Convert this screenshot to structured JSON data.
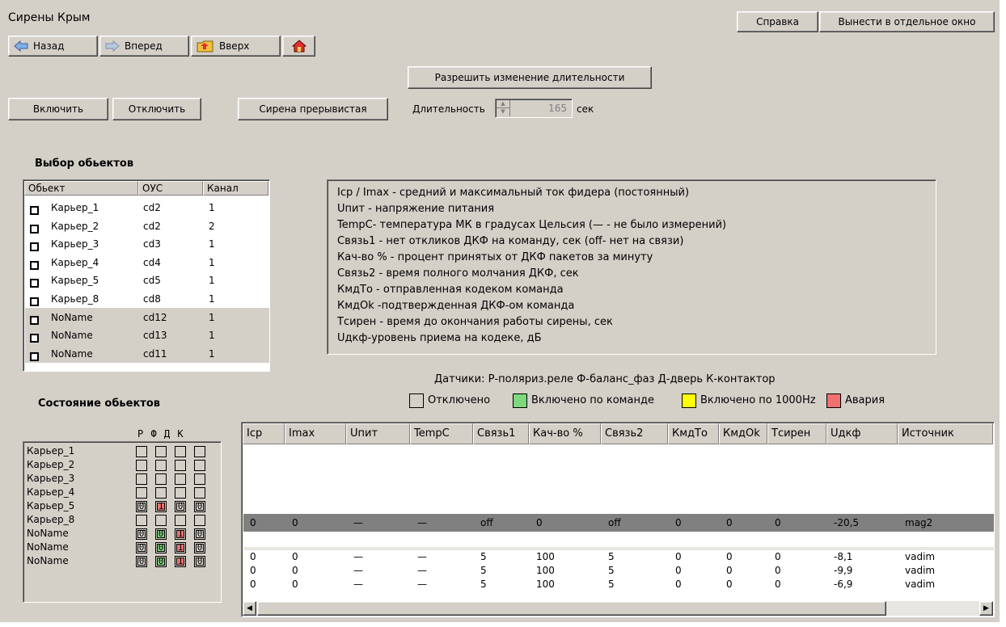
{
  "window": {
    "title": "Сирены Крым"
  },
  "top_buttons": {
    "help": "Справка",
    "detach": "Вынести в отдельное окно"
  },
  "nav": {
    "back": "Назад",
    "forward": "Вперед",
    "up": "Вверх"
  },
  "controls": {
    "allow_duration": "Разрешить изменение длительности",
    "on": "Включить",
    "off": "Отключить",
    "siren_mode": "Сирена прерывистая",
    "duration_label": "Длительность",
    "duration_value": "165",
    "duration_unit": "сек"
  },
  "objects": {
    "title": "Выбор обьектов",
    "headers": [
      "Обьект",
      "ОУС",
      "Канал"
    ],
    "rows": [
      {
        "name": "Карьер_1",
        "ous": "cd2",
        "channel": "1"
      },
      {
        "name": "Карьер_2",
        "ous": "cd2",
        "channel": "2"
      },
      {
        "name": "Карьер_3",
        "ous": "cd3",
        "channel": "1"
      },
      {
        "name": "Карьер_4",
        "ous": "cd4",
        "channel": "1"
      },
      {
        "name": "Карьер_5",
        "ous": "cd5",
        "channel": "1"
      },
      {
        "name": "Карьер_8",
        "ous": "cd8",
        "channel": "1"
      },
      {
        "name": "NoName",
        "ous": "cd12",
        "channel": "1"
      },
      {
        "name": "NoName",
        "ous": "cd13",
        "channel": "1"
      },
      {
        "name": "NoName",
        "ous": "cd11",
        "channel": "1"
      }
    ]
  },
  "legend": {
    "lines": [
      "Icp / Imax - средний и максимальный ток фидера (постоянный)",
      "Uпит - напряжение питания",
      "TempC- температура МК в градусах Цельсия (— - не было измерений)",
      "Связь1 - нет откликов ДКФ на команду, сек (off- нет на связи)",
      "Кач-во % - процент принятых от ДКФ пакетов за минуту",
      "Связь2 - время полного молчания ДКФ, сек",
      "КмдТо - отправленная кодеком команда",
      "КмдOk -подтвержденная  ДКФ-ом команда",
      "Тсирен - время до окончания работы сирены, сек",
      "Uдкф-уровень приема на кодеке, дБ"
    ],
    "sensors": "Датчики: Р-поляриз.реле  Ф-баланс_фаз  Д-дверь  К-контактор",
    "status": [
      {
        "label": "Отключено",
        "color": "#d4d0c8"
      },
      {
        "label": "Включено по команде",
        "color": "#7ed87e"
      },
      {
        "label": "Включено по 1000Hz",
        "color": "#ffff00"
      },
      {
        "label": "Авария",
        "color": "#f07070"
      }
    ]
  },
  "state": {
    "title": "Состояние обьектов",
    "sensor_headers": "Р Ф Д К",
    "rows": [
      {
        "name": "Карьер_1",
        "cells": [
          "",
          "",
          "",
          ""
        ],
        "colors": [
          "",
          "",
          "",
          ""
        ]
      },
      {
        "name": "Карьер_2",
        "cells": [
          "",
          "",
          "",
          ""
        ],
        "colors": [
          "",
          "",
          "",
          ""
        ]
      },
      {
        "name": "Карьер_3",
        "cells": [
          "",
          "",
          "",
          ""
        ],
        "colors": [
          "",
          "",
          "",
          ""
        ]
      },
      {
        "name": "Карьер_4",
        "cells": [
          "",
          "",
          "",
          ""
        ],
        "colors": [
          "",
          "",
          "",
          ""
        ]
      },
      {
        "name": "Карьер_5",
        "cells": [
          "0",
          "1",
          "0",
          "0"
        ],
        "colors": [
          "",
          "#f07070",
          "",
          ""
        ]
      },
      {
        "name": "Карьер_8",
        "cells": [
          "",
          "",
          "",
          ""
        ],
        "colors": [
          "",
          "",
          "",
          ""
        ]
      },
      {
        "name": "NoName",
        "cells": [
          "0",
          "0",
          "1",
          "0"
        ],
        "colors": [
          "",
          "#7ed87e",
          "#f07070",
          ""
        ]
      },
      {
        "name": "NoName",
        "cells": [
          "0",
          "0",
          "1",
          "0"
        ],
        "colors": [
          "",
          "#7ed87e",
          "#f07070",
          ""
        ]
      },
      {
        "name": "NoName",
        "cells": [
          "0",
          "0",
          "1",
          "0"
        ],
        "colors": [
          "",
          "#7ed87e",
          "#f07070",
          ""
        ]
      }
    ]
  },
  "grid": {
    "headers": [
      "Icp",
      "Imax",
      "Uпит",
      "TempC",
      "Связь1",
      "Кач-во %",
      "Связь2",
      "КмдТо",
      "КмдOk",
      "Тсирен",
      "Uдкф",
      "Источник"
    ],
    "rows": [
      {
        "values": [
          "0",
          "0",
          "—",
          "—",
          "off",
          "0",
          "off",
          "0",
          "0",
          "0",
          "-20,5",
          "mag2"
        ]
      },
      {
        "values": [
          "0",
          "0",
          "—",
          "—",
          "5",
          "100",
          "5",
          "0",
          "0",
          "0",
          "-8,1",
          "vadim"
        ]
      },
      {
        "values": [
          "0",
          "0",
          "—",
          "—",
          "5",
          "100",
          "5",
          "0",
          "0",
          "0",
          "-9,9",
          "vadim"
        ]
      },
      {
        "values": [
          "0",
          "0",
          "—",
          "—",
          "5",
          "100",
          "5",
          "0",
          "0",
          "0",
          "-6,9",
          "vadim"
        ]
      }
    ]
  }
}
